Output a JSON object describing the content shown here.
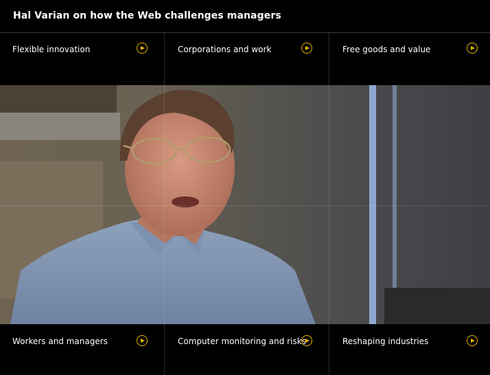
{
  "header": {
    "title": "Hal Varian on how the Web challenges managers"
  },
  "menu_top": [
    {
      "label": "Flexible innovation",
      "icon": "play-icon"
    },
    {
      "label": "Corporations and work",
      "icon": "play-icon"
    },
    {
      "label": "Free goods and value",
      "icon": "play-icon"
    }
  ],
  "menu_bottom": [
    {
      "label": "Workers and managers",
      "icon": "play-icon"
    },
    {
      "label": "Computer monitoring and risks",
      "icon": "play-icon"
    },
    {
      "label": "Reshaping industries",
      "icon": "play-icon"
    }
  ],
  "colors": {
    "accent": "#f0b400",
    "background": "#000000",
    "text": "#ffffff"
  }
}
